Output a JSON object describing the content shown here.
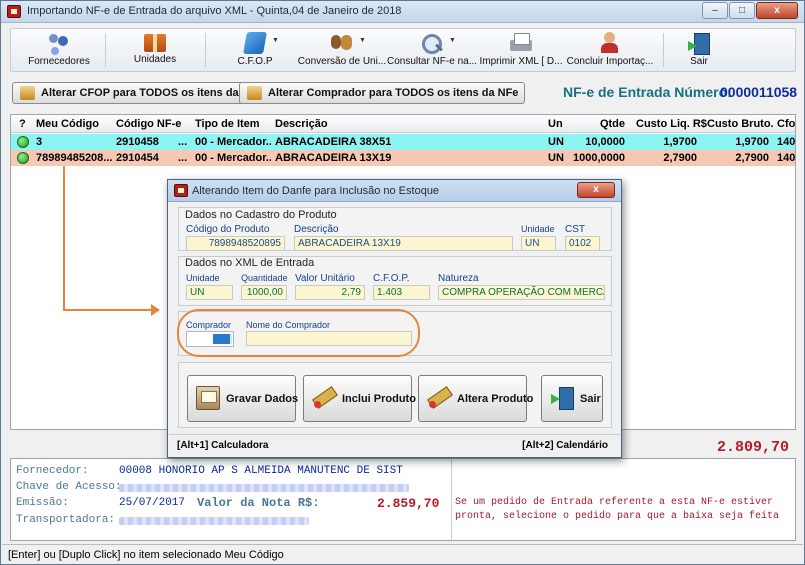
{
  "window": {
    "title": "Importando NF-e de Entrada do arquivo XML - Quinta,04 de Janeiro de 2018",
    "controls": {
      "minimize": "–",
      "maximize": "□",
      "close": "x"
    }
  },
  "toolbar": [
    {
      "label": "Fornecedores",
      "icon": "people-icon"
    },
    {
      "label": "Unidades",
      "icon": "box-icon"
    },
    {
      "label": "C.F.O.P",
      "icon": "book-icon"
    },
    {
      "label": "Conversão de Uni...",
      "icon": "people-convert-icon"
    },
    {
      "label": "Consultar NF-e na...",
      "icon": "search-icon"
    },
    {
      "label": "Imprimir XML [ D...",
      "icon": "printer-icon"
    },
    {
      "label": "Concluir Importaç...",
      "icon": "person-icon"
    },
    {
      "label": "Sair",
      "icon": "exit-icon"
    }
  ],
  "actions": {
    "alter_cfop": "Alterar CFOP para TODOS os itens da NFe",
    "alter_buyer": "Alterar Comprador para TODOS os itens da NFe"
  },
  "nfe": {
    "label": "NF-e de Entrada Número:",
    "number": "0000011058"
  },
  "grid": {
    "headers": [
      "?",
      "Meu Código",
      "Código NF-e",
      "Tipo de Item",
      "Descrição",
      "Un",
      "Qtde",
      "Custo Liq. R$",
      "Custo Bruto...",
      "Cfo"
    ],
    "rows": [
      {
        "meu_codigo": "3",
        "codigo_nfe": "2910458",
        "dots": "...",
        "tipo": "00 - Mercador...",
        "descricao": "ABRACADEIRA 38X51",
        "un": "UN",
        "qtde": "10,0000",
        "custo_liq": "1,9700",
        "custo_bruto": "1,9700",
        "cfo": "140"
      },
      {
        "meu_codigo": "78989485208...",
        "codigo_nfe": "2910454",
        "dots": "...",
        "tipo": "00 - Mercador...",
        "descricao": "ABRACADEIRA 13X19",
        "un": "UN",
        "qtde": "1000,0000",
        "custo_liq": "2,7900",
        "custo_bruto": "2,7900",
        "cfo": "140"
      }
    ]
  },
  "total": "2.809,70",
  "info": {
    "fornecedor_label": "Fornecedor:",
    "fornecedor_value": "00008 HONORIO AP S ALMEIDA MANUTENC DE SIST",
    "chave_label": "Chave de Acesso:",
    "emissao_label": "Emissão:",
    "emissao_value": "25/07/2017",
    "valor_label": "Valor da Nota R$:",
    "valor_value": "2.859,70",
    "transportadora_label": "Transportadora:",
    "hint_line1": "Se um pedido de Entrada referente a esta NF-e estiver",
    "hint_line2": "pronta, selecione o pedido para que a baixa seja feita"
  },
  "statusbar": "[Enter] ou [Duplo Click] no item selecionado Meu Código",
  "dialog": {
    "title": "Alterando Item do Danfe para Inclusão no Estoque",
    "close": "x",
    "cadastro": {
      "heading": "Dados no Cadastro do Produto",
      "codigo_label": "Código do Produto",
      "codigo_value": "7898948520895",
      "descricao_label": "Descrição",
      "descricao_value": "ABRACADEIRA 13X19",
      "unidade_label": "Unidade",
      "unidade_value": "UN",
      "cst_label": "CST",
      "cst_value": "0102"
    },
    "xml": {
      "heading": "Dados no XML de Entrada",
      "unidade_label": "Unidade",
      "unidade_value": "UN",
      "quantidade_label": "Quantidade",
      "quantidade_value": "1000,00",
      "valor_label": "Valor Unitário",
      "valor_value": "2,79",
      "cfop_label": "C.F.O.P.",
      "cfop_value": "1.403",
      "natureza_label": "Natureza",
      "natureza_value": "COMPRA OPERAÇÃO COM MERCAD"
    },
    "comprador": {
      "comprador_label": "Comprador",
      "nome_label": "Nome do Comprador",
      "nome_value": ""
    },
    "buttons": {
      "gravar": "Gravar Dados",
      "inclui": "Inclui Produto",
      "altera": "Altera Produto",
      "sair": "Sair"
    },
    "status_left": "[Alt+1] Calculadora",
    "status_right": "[Alt+2] Calendário"
  },
  "colors": {
    "row_selected": "#8df4f4",
    "row_edited": "#f6c7b3",
    "nfe_title": "#1a6e86",
    "nfe_number": "#0b2f9e",
    "total": "#b41b2a",
    "annotation": "#e7843a"
  }
}
